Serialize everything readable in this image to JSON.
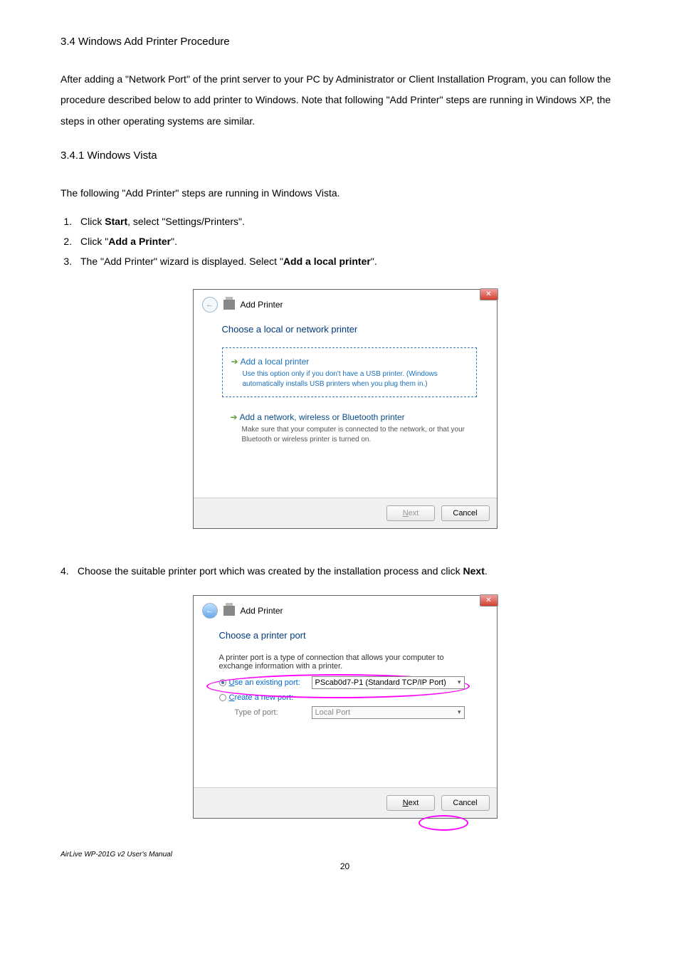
{
  "heading_3_4": "3.4 Windows Add Printer Procedure",
  "para1": "After adding a \"Network Port\" of the print server to your PC by Administrator or Client Installation Program, you can follow the procedure described below to add printer to Windows. Note that following \"Add Printer\" steps are running in Windows XP, the steps in other operating systems are similar.",
  "heading_3_4_1": "3.4.1 Windows Vista",
  "para2": "The following \"Add Printer\" steps are running in Windows Vista.",
  "steps": {
    "s1a": "Click ",
    "s1b": "Start",
    "s1c": ", select \"Settings/Printers\".",
    "s2a": "Click \"",
    "s2b": "Add a Printer",
    "s2c": "\".",
    "s3a": "The \"Add Printer\" wizard is displayed. Select \"",
    "s3b": "Add a local printer",
    "s3c": "\"."
  },
  "dialog1": {
    "title": "Add Printer",
    "subtitle": "Choose a local or network printer",
    "opt1_title": "Add a local printer",
    "opt1_desc": "Use this option only if you don't have a USB printer. (Windows automatically installs USB printers when you plug them in.)",
    "opt2_title": "Add a network, wireless or Bluetooth printer",
    "opt2_desc": "Make sure that your computer is connected to the network, or that your Bluetooth or wireless printer is turned on.",
    "btn_next": "Next",
    "btn_cancel": "Cancel"
  },
  "step4": {
    "num": "4.",
    "a": "Choose the suitable printer port which was created by the installation process and click ",
    "b": "Next",
    "c": "."
  },
  "dialog2": {
    "title": "Add Printer",
    "subtitle": "Choose a printer port",
    "desc": "A printer port is a type of connection that allows your computer to exchange information with a printer.",
    "use_existing": "Use an existing port:",
    "port_value": "PScab0d7-P1 (Standard TCP/IP Port)",
    "create_new": "Create a new port:",
    "type_of_port": "Type of port:",
    "local_port": "Local Port",
    "btn_next": "Next",
    "btn_cancel": "Cancel"
  },
  "footer": "AirLive WP-201G v2 User's Manual",
  "page_num": "20"
}
